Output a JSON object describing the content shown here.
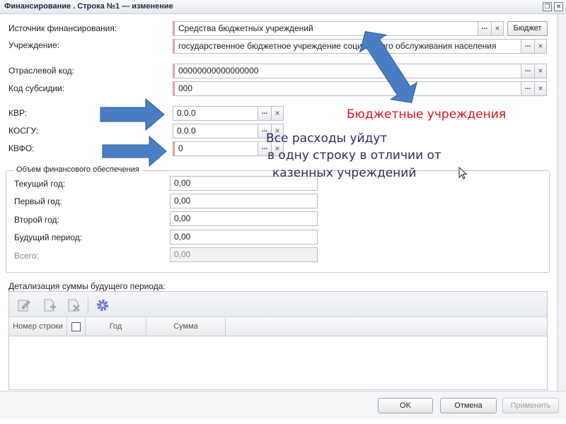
{
  "window": {
    "title": "Финансирование . Строка №1 — изменение",
    "restore_glyph": "❐",
    "close_glyph": "✕"
  },
  "form": {
    "source_label": "Источник финансирования:",
    "source_value": "Средства бюджетных учреждений",
    "budget_button": "Бюджет",
    "institution_label": "Учреждение:",
    "institution_value": "государственное бюджетное учреждение социального обслуживания населения",
    "industry_code_label": "Отраслевой код:",
    "industry_code_value": "00000000000000000",
    "subsidy_code_label": "Код субсидии:",
    "subsidy_code_value": "000",
    "kvr_label": "КВР:",
    "kvr_value": "0.0.0",
    "kosgu_label": "КОСГУ:",
    "kosgu_value": "0.0.0",
    "kvfo_label": "КВФО:",
    "kvfo_value": "0",
    "dots": "...",
    "clear": "×"
  },
  "volume_group": {
    "title": "Объем финансового обеспечения",
    "rows": [
      {
        "label": "Текущий год:",
        "value": "0,00"
      },
      {
        "label": "Первый год:",
        "value": "0,00"
      },
      {
        "label": "Второй год:",
        "value": "0,00"
      },
      {
        "label": "Будущий период:",
        "value": "0,00"
      },
      {
        "label": "Всего:",
        "value": "0,00"
      }
    ]
  },
  "detail": {
    "title": "Детализация суммы будущего периода:",
    "toolbar_icons": [
      "edit-icon",
      "add-row-icon",
      "delete-row-icon",
      "settings-gear-icon"
    ],
    "columns": {
      "row_number": "Номер строки",
      "year": "Год",
      "sum": "Сумма"
    }
  },
  "footer": {
    "ok": "OK",
    "cancel": "Отмена",
    "apply": "Применить"
  },
  "annotations": {
    "budget_institutions": "Бюджетные учреждения",
    "line1": "Все расходы уйдут",
    "line2": "в одну строку в отличии от",
    "line3": "казенных учреждений"
  },
  "colors": {
    "arrow_fill": "#4a7ec4",
    "arrow_stroke": "#2e5a96",
    "required_marker": "#e3a2a2",
    "annotation_red": "#e0141a"
  }
}
